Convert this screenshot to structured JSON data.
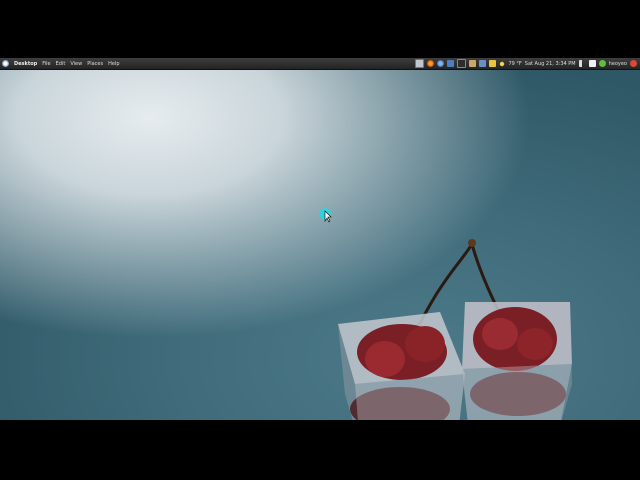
{
  "panel": {
    "menus": [
      "Desktop",
      "File",
      "Edit",
      "View",
      "Places",
      "Help"
    ],
    "weather": "79 °F",
    "clock": "Sat Aug 21,  3:34 PM",
    "user": "heoyeo",
    "tray_icons": [
      "panel-square-icon",
      "firefox-icon",
      "thunderbird-icon",
      "network-icon",
      "terminal-icon",
      "folder-icon",
      "gear-icon",
      "mail-icon",
      "sun-icon",
      "volume-icon",
      "chat-icon",
      "status-icon",
      "power-icon"
    ]
  },
  "desktop": {
    "wallpaper": "frozen-cherries",
    "accent": "#3b6776"
  }
}
